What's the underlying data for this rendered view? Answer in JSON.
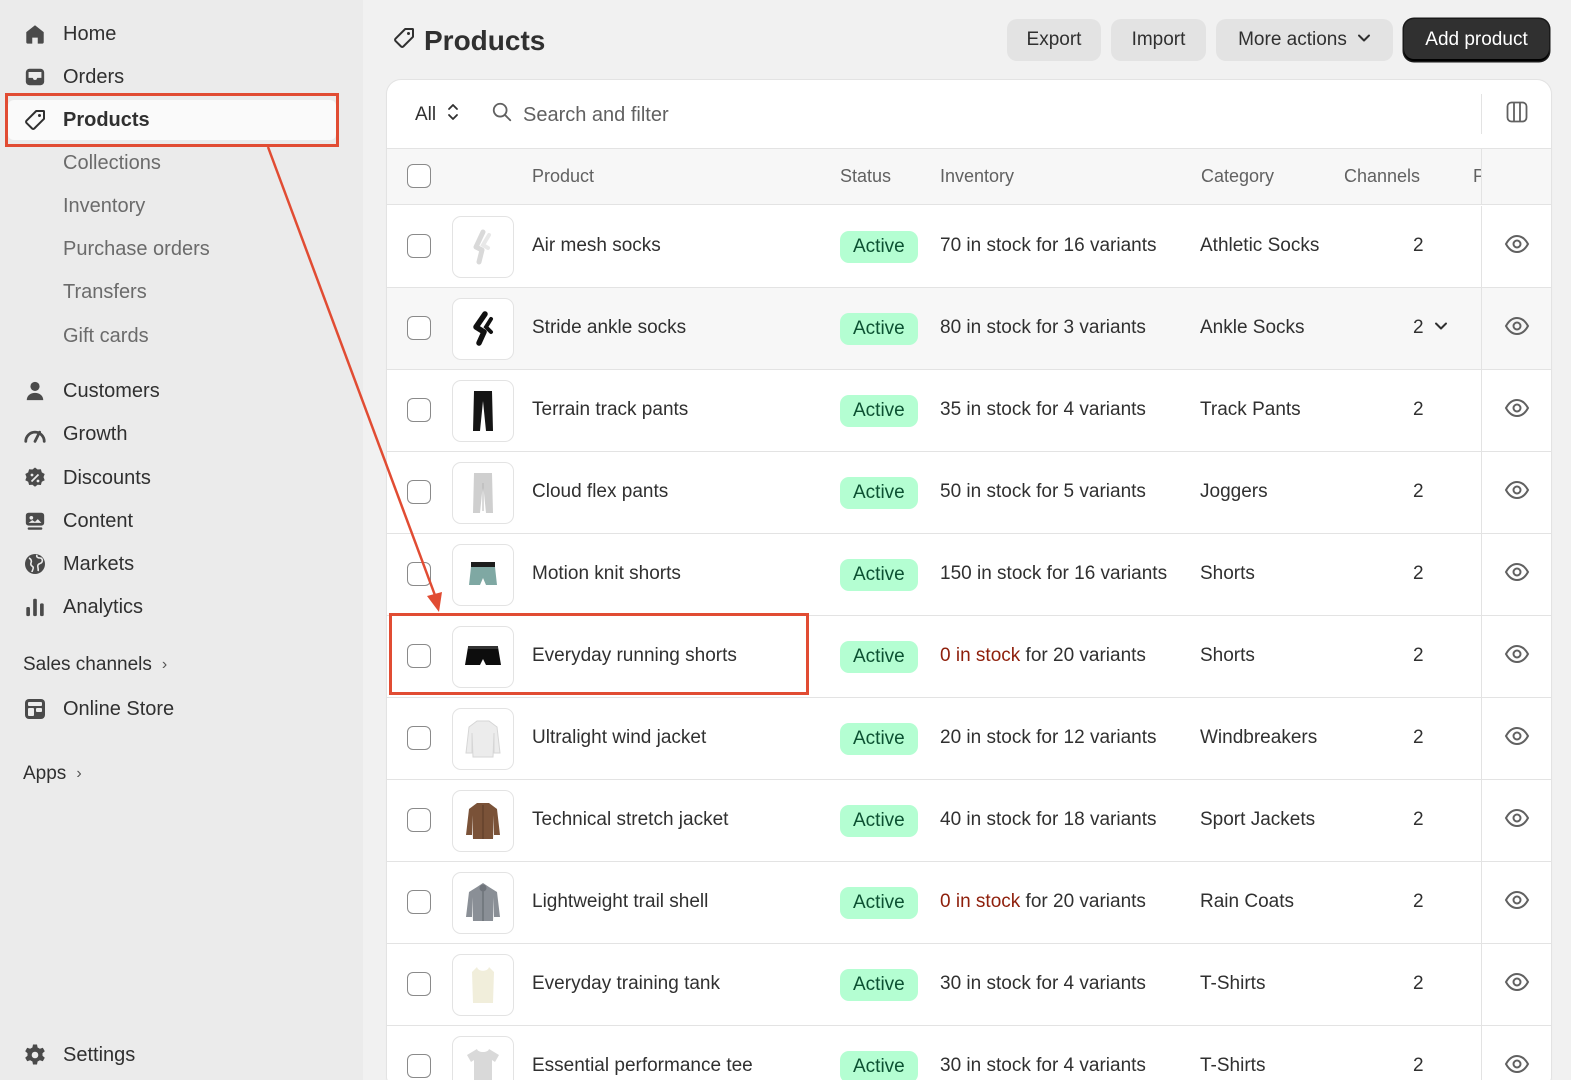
{
  "sidebar": {
    "nav": [
      {
        "id": "home",
        "label": "Home",
        "icon": "home-icon"
      },
      {
        "id": "orders",
        "label": "Orders",
        "icon": "inbox-icon"
      },
      {
        "id": "products",
        "label": "Products",
        "icon": "tag-icon",
        "active": true
      }
    ],
    "sub": [
      "Collections",
      "Inventory",
      "Purchase orders",
      "Transfers",
      "Gift cards"
    ],
    "main": [
      {
        "id": "customers",
        "label": "Customers",
        "icon": "person-icon"
      },
      {
        "id": "growth",
        "label": "Growth",
        "icon": "gauge-icon"
      },
      {
        "id": "discounts",
        "label": "Discounts",
        "icon": "discount-icon"
      },
      {
        "id": "content",
        "label": "Content",
        "icon": "content-icon"
      },
      {
        "id": "markets",
        "label": "Markets",
        "icon": "globe-icon"
      },
      {
        "id": "analytics",
        "label": "Analytics",
        "icon": "bar-chart-icon"
      }
    ],
    "sales_channels_label": "Sales channels",
    "online_store_label": "Online Store",
    "apps_label": "Apps",
    "settings_label": "Settings"
  },
  "header": {
    "title": "Products",
    "export_label": "Export",
    "import_label": "Import",
    "more_actions_label": "More actions",
    "add_product_label": "Add product"
  },
  "filter": {
    "view_label": "All",
    "search_placeholder": "Search and filter"
  },
  "table": {
    "columns": {
      "product": "Product",
      "status": "Status",
      "inventory": "Inventory",
      "category": "Category",
      "channels": "Channels",
      "extra": "P"
    },
    "rows": [
      {
        "name": "Air mesh socks",
        "status": "Active",
        "stock": "70 in stock",
        "variants": " for 16 variants",
        "zero": false,
        "category": "Athletic Socks",
        "channels": "2",
        "thumb": "sock-light"
      },
      {
        "name": "Stride ankle socks",
        "status": "Active",
        "stock": "80 in stock",
        "variants": " for 3 variants",
        "zero": false,
        "category": "Ankle Socks",
        "channels": "2",
        "thumb": "sock-dark",
        "hover": true,
        "dropdown": true
      },
      {
        "name": "Terrain track pants",
        "status": "Active",
        "stock": "35 in stock",
        "variants": " for 4 variants",
        "zero": false,
        "category": "Track Pants",
        "channels": "2",
        "thumb": "pants-dark"
      },
      {
        "name": "Cloud flex pants",
        "status": "Active",
        "stock": "50 in stock",
        "variants": " for 5 variants",
        "zero": false,
        "category": "Joggers",
        "channels": "2",
        "thumb": "pants-light"
      },
      {
        "name": "Motion knit shorts",
        "status": "Active",
        "stock": "150 in stock",
        "variants": " for 16 variants",
        "zero": false,
        "category": "Shorts",
        "channels": "2",
        "thumb": "shorts-teal"
      },
      {
        "name": "Everyday running shorts",
        "status": "Active",
        "stock": "0 in stock",
        "variants": " for 20 variants",
        "zero": true,
        "category": "Shorts",
        "channels": "2",
        "thumb": "shorts-black"
      },
      {
        "name": "Ultralight wind jacket",
        "status": "Active",
        "stock": "20 in stock",
        "variants": " for 12 variants",
        "zero": false,
        "category": "Windbreakers",
        "channels": "2",
        "thumb": "jacket-white"
      },
      {
        "name": "Technical stretch jacket",
        "status": "Active",
        "stock": "40 in stock",
        "variants": " for 18 variants",
        "zero": false,
        "category": "Sport Jackets",
        "channels": "2",
        "thumb": "jacket-brown"
      },
      {
        "name": "Lightweight trail shell",
        "status": "Active",
        "stock": "0 in stock",
        "variants": " for 20 variants",
        "zero": true,
        "category": "Rain Coats",
        "channels": "2",
        "thumb": "jacket-grey"
      },
      {
        "name": "Everyday training tank",
        "status": "Active",
        "stock": "30 in stock",
        "variants": " for 4 variants",
        "zero": false,
        "category": "T-Shirts",
        "channels": "2",
        "thumb": "tank-cream"
      },
      {
        "name": "Essential performance tee",
        "status": "Active",
        "stock": "30 in stock",
        "variants": " for 4 variants",
        "zero": false,
        "category": "T-Shirts",
        "channels": "2",
        "thumb": "tee-grey"
      }
    ]
  },
  "colors": {
    "annotation": "#e14c33",
    "badge_bg": "#b4fed2",
    "badge_text": "#0c5132",
    "zero_stock": "#8e1f0b"
  }
}
